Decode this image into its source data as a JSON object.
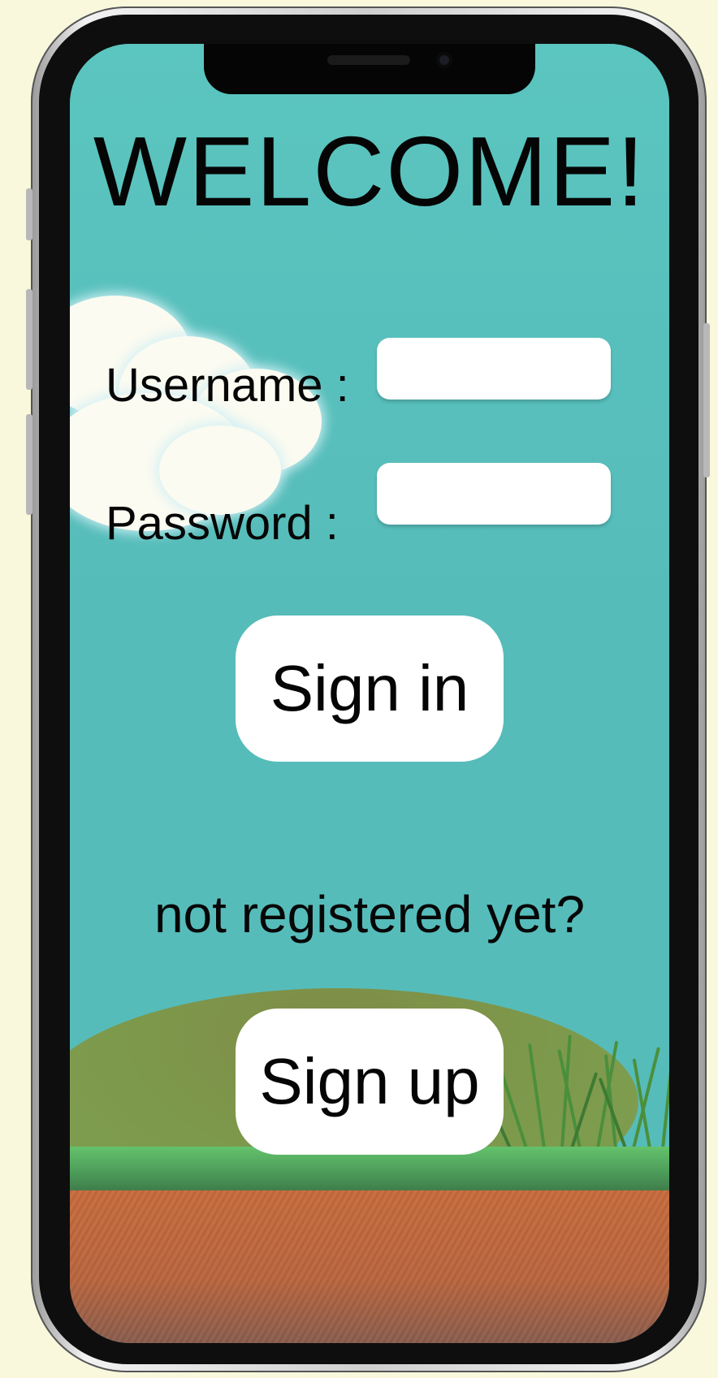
{
  "title": "WELCOME!",
  "form": {
    "username_label": "Username :",
    "username_value": "",
    "password_label": "Password :",
    "password_value": ""
  },
  "actions": {
    "sign_in_label": "Sign in",
    "prompt_text": "not registered yet?",
    "sign_up_label": "Sign up"
  },
  "colors": {
    "sky": "#56bcba",
    "button": "#ffffff",
    "grass": "#5cb968",
    "dirt": "#c06a3e",
    "page_background": "#f9f8dc"
  }
}
